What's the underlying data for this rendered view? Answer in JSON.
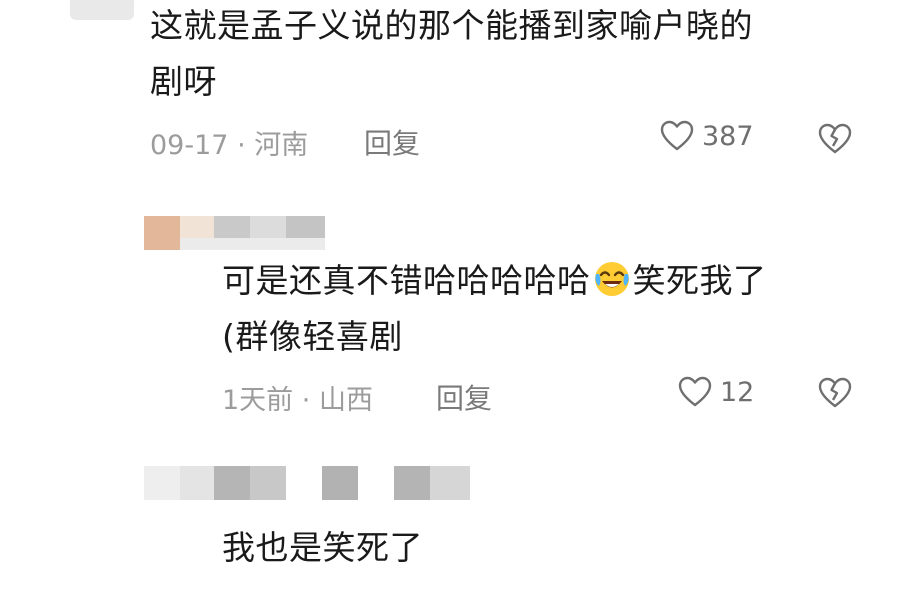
{
  "comments": [
    {
      "text_line1": "这就是孟子义说的那个能播到家喻户晓的",
      "text_line2": "剧呀",
      "date": "09-17",
      "location": "河南",
      "reply_label": "回复",
      "likes": "387"
    },
    {
      "text_part1": "可是还真不错哈哈哈哈哈",
      "emoji": "laughing-tears",
      "text_part2": "笑死我了",
      "text_line2": "(群像轻喜剧",
      "date": "1天前",
      "location": "山西",
      "reply_label": "回复",
      "likes": "12"
    },
    {
      "text_line1": "我也是笑死了"
    }
  ],
  "meta_separator": "·",
  "colors": {
    "meta": "#9c9c9c",
    "icon": "#6f6f6f",
    "text": "#1a1a1a"
  }
}
